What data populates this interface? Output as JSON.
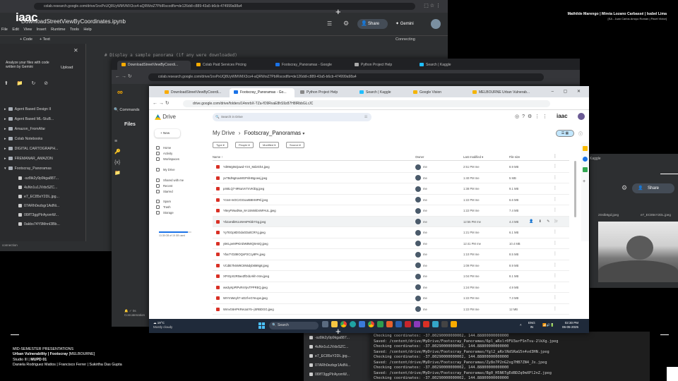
{
  "slide": {
    "authors_line1": "Mathilde Marengo | Mireia Lozano Carbassé | Isabel Lima",
    "authors_line2": "[SA - Juan Carlos Arroyo Roman | Pavel Victor]",
    "logo_text": "iaac",
    "footer": {
      "line1": "MID-SEMESTER PRESENTATIONS",
      "line2_bold": "Urban Vulnerability | Footscray",
      "line2_rest": " [MELBOURNE]",
      "line3_a": "Studio III | ",
      "line3_b": "MUPD 01",
      "line4": "Daniela Rodriguez Mattos | Francisco Ferrer | Sukirtha Das Gupta"
    }
  },
  "colab_back": {
    "url": "colab.research.google.com/drive/1nxPxUQ8UyWMVMX3cs4-aQRWoiZ7PbIRscodfls=de126ddl-c889-43a5-b6cb-474999a98a4",
    "title": "DownloadStreetViewByCoordinates.ipynb",
    "menu": [
      "File",
      "Edit",
      "View",
      "Insert",
      "Runtime",
      "Tools",
      "Help"
    ],
    "share_label": "Share",
    "gemini_label": "Gemini",
    "connecting_label": "Connecting",
    "toolbar": [
      "+ Code",
      "+ Text"
    ],
    "code_line": "# Display a sample panorama (if any were downloaded)",
    "gemini_prompt": "Analyze your files with code written by Gemini",
    "upload_label": "Upload",
    "folders": [
      "Agent Based Design II",
      "Agent Based ML-StuB...",
      "Amazon_FromAfar",
      "Colab Notebooks",
      "DIGITAL CARTOGRAPH...",
      "FREMANAR_AMAZON",
      "Footscray_Panoramas"
    ],
    "files": [
      "-sz8ik2y9p9kga887...",
      "4uNn1u1JVdsSZC...",
      "e7_EC85sY2DL.jpg...",
      "07ARh0ezbgr1AdNi...",
      "0l9fT3ggPIrAyomW...",
      "0akbs74Y9Mnnl3Bb..."
    ],
    "status": "connection"
  },
  "mid_browser": {
    "tabs": [
      "DownloadStreetViewByCoordi...",
      "Colab Paid Services Pricing",
      "Footscray_Panoramas - Google",
      "Python Project Help",
      "Search | Kaggle"
    ],
    "url": "colab.research.google.com/drive/1nxPxUQ8UyWMVMX3cs4-aQRWoiZ7PbIRscodfls=de126ddl-c889-43a5-b6cb-474999a98a4",
    "files_title": "Files",
    "commands_label": "Commands",
    "status": "Concatenation"
  },
  "front_browser": {
    "tabs": [
      "DownloadStreetViewByCoordi...",
      "Footscray_Panoramas - Go...",
      "Python Project Help",
      "Search | Kaggle",
      "Google Vision",
      "MELBOURNE Urban Vulnerab..."
    ],
    "url": "drive.google.com/drive/folders/14nnrbX-TZa-fO9RvaE8hS9z87H8lRbbGLrJC"
  },
  "drive": {
    "app_name": "Drive",
    "search_placeholder": "Search in Drive",
    "new_label": "New",
    "nav": [
      "Home",
      "Activity",
      "Workspaces",
      "My Drive",
      "Shared with me",
      "Recent",
      "Starred",
      "Spam",
      "Trash",
      "Storage"
    ],
    "storage_text": "13.35 GB of 15 GB used",
    "breadcrumb_root": "My Drive",
    "breadcrumb_folder": "Footscray_Panoramas",
    "filters": [
      "Type",
      "People",
      "Modified",
      "Source"
    ],
    "columns": {
      "name": "Name",
      "owner": "Owner",
      "modified": "Last modified",
      "size": "File size"
    },
    "rows": [
      {
        "name": "Yd9Wg0sQawd-YzX_Md2Gh4.jpeg",
        "owner": "me",
        "modified": "2:51 PM me",
        "size": "8.9 MB"
      },
      {
        "name": "yvTBdNgKaxMGPnlHBgoeej.jpeg",
        "owner": "me",
        "modified": "1:40 PM me",
        "size": "5 MB"
      },
      {
        "name": "p46tLQ7-9RsaVnTnVKlDg.jpeg",
        "owner": "me",
        "modified": "1:38 PM me",
        "size": "9.1 MB"
      },
      {
        "name": "Ycsvt-mOCzGGoarB8HMPKl.jpeg",
        "owner": "me",
        "modified": "1:22 PM me",
        "size": "6.6 MB"
      },
      {
        "name": "Y8eyFMwdNw_M-1SMnkbnNPAUL.jpeg",
        "owner": "me",
        "modified": "1:22 PM me",
        "size": "7.4 MB"
      },
      {
        "name": "Yb2aHdkN1oNHsPKbb7Gg.jpeg",
        "owner": "me",
        "modified": "12:55 PM me",
        "size": "4.4 MB"
      },
      {
        "name": "Yy7EGp8DOdaGDaltCRYg.jpeg",
        "owner": "me",
        "modified": "1:21 PM me",
        "size": "6.1 MB"
      },
      {
        "name": "y5KLpeMPKinDWBWQ5H4Q.jpeg",
        "owner": "me",
        "modified": "12:41 PM me",
        "size": "10.4 MB"
      },
      {
        "name": "Yba7YD28IOQnP2C1y8PA.jpeg",
        "owner": "me",
        "modified": "1:10 PM me",
        "size": "8.5 MB"
      },
      {
        "name": "VCdtE7k6W9C8N5dyb6M8g8.jpeg",
        "owner": "me",
        "modified": "1:09 PM me",
        "size": "8.9 MB"
      },
      {
        "name": "XPrGpX2R0aeZfDdLHkh-Xmv.jpeg",
        "owner": "me",
        "modified": "1:04 PM me",
        "size": "8.1 MB"
      },
      {
        "name": "ww3yKpPtPvRsYpvTPPREQ.jpeg",
        "owner": "me",
        "modified": "1:24 PM me",
        "size": "4.9 MB"
      },
      {
        "name": "WrYmWeyh7-oD2f-eGYeuyw.jpeg",
        "owner": "me",
        "modified": "1:22 PM me",
        "size": "7.3 MB"
      },
      {
        "name": "WmvG6HPKReUatY5--jSRBDGG.jpeg",
        "owner": "me",
        "modified": "1:22 PM me",
        "size": "12 MB"
      }
    ]
  },
  "taskbar": {
    "weather_temp": "19°C",
    "weather_desc": "Mostly cloudy",
    "search_label": "Search",
    "lang": "ENG",
    "region": "IN",
    "time": "02:30 PM",
    "date": "06-05-2025"
  },
  "right_window": {
    "share_label": "Share",
    "file_label": "2Sslb8gd.jpeg",
    "file_label2": "e7_EC85sY2DL.jpeg",
    "close_label": "Kaggle"
  },
  "bottom_files": [
    "-sz8ik2y9p9kga887...",
    "4uNn1u1JVdsSZC...",
    "e7_EC85sY2DL.jpg...",
    "07ARh0ezbgr1AdNi...",
    "0l9fT3ggPIrAyomW..."
  ],
  "terminal": [
    "Checking coordinates: -37.80290000000002, 144.88800000000000",
    "Saved: /content/drive/MyDrive/Footscray_Panoramas/6pl_aRxlr0FU3arFSnTsu-2lkXg.jpeg",
    "Checking coordinates: -37.80290000000002, 144.88800000000000",
    "Saved: /content/drive/MyDrive/Footscray_Panoramas/Ygl2_aRxlNdSRaG5n4vd3HN.jpeg",
    "Checking coordinates: -37.80290000000002, 144.88800000000000",
    "Saved: /content/drive/MyDrive/Footscray_Panoramas/Zy8o7P2nG2xg7HB7ZN4_Jx.jpeg",
    "Checking coordinates: -37.80290000000002, 144.88800000000000",
    "Saved: /content/drive/MyDrive/Footscray_Panoramas/Bg0_H5N6TgEdBDZq0mXPl2nZ.jpeg",
    "Checking coordinates: -37.80290000000002, 144.88800000000000"
  ],
  "colors": {
    "drive_blue": "#1a73e8",
    "taskbar": "#1f2a3a",
    "colab_dark": "#2d2f31",
    "browser_tab": "#3c3c3c"
  }
}
